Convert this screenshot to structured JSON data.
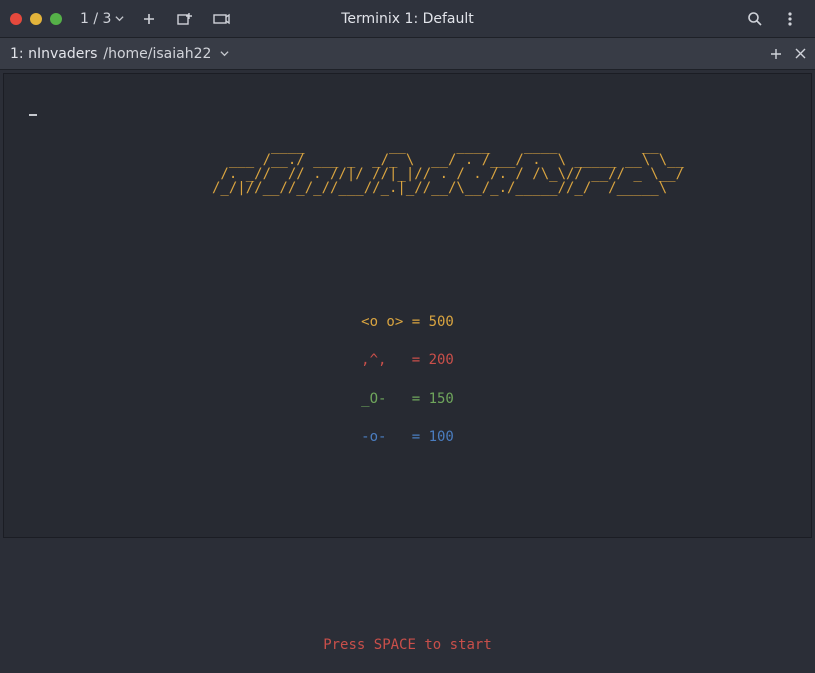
{
  "titlebar": {
    "page_indicator": "1 / 3",
    "window_title": "Terminix 1: Default"
  },
  "tab": {
    "label": "1: nInvaders",
    "path": "/home/isaiah22"
  },
  "terminal": {
    "logo_lines": [
      "       ____          __      ____    ____          __",
      "  ___ /__./ ___ _  _/_ \\  __/ . /___/ .  \\ _____ __\\ \\__",
      " /. _//  // . //|/ //|_|// . / . /. / /\\_\\// __// _ \\__/",
      "/_/|//__//_/_//___//_.|_//__/\\__/_./_____//_/  /_____\\"
    ],
    "scores": [
      {
        "sprite": "<o o>",
        "points": "500",
        "color": "c-yellow"
      },
      {
        "sprite": ",^,  ",
        "points": "200",
        "color": "c-red"
      },
      {
        "sprite": "_O-  ",
        "points": "150",
        "color": "c-green"
      },
      {
        "sprite": "-o-  ",
        "points": "100",
        "color": "c-blue"
      }
    ],
    "start_message": "Press SPACE to start"
  }
}
